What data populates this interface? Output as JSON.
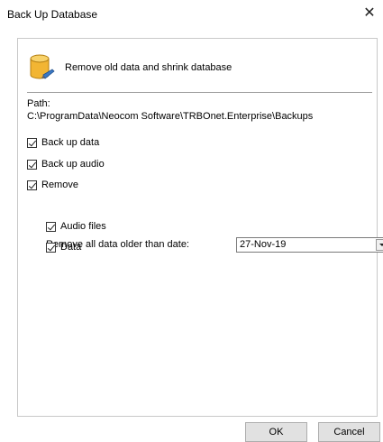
{
  "window": {
    "title": "Back Up Database"
  },
  "header": {
    "subtitle": "Remove old data and shrink database"
  },
  "path": {
    "label": "Path:",
    "value": "C:\\ProgramData\\Neocom Software\\TRBOnet.Enterprise\\Backups"
  },
  "options": {
    "backup_data": {
      "label": "Back up data",
      "checked": true
    },
    "backup_audio": {
      "label": "Back up audio",
      "checked": true
    },
    "remove": {
      "label": "Remove",
      "checked": true
    },
    "remove_older_label": "Remove all data older than date:",
    "date_value": "27-Nov-19",
    "audio_files": {
      "label": "Audio files",
      "checked": true
    },
    "data": {
      "label": "Data",
      "checked": true
    }
  },
  "buttons": {
    "ok": "OK",
    "cancel": "Cancel"
  },
  "icons": {
    "database": "database-icon",
    "close": "close-icon"
  },
  "colors": {
    "db_body": "#f2b533",
    "accent": "#3a78c4"
  }
}
